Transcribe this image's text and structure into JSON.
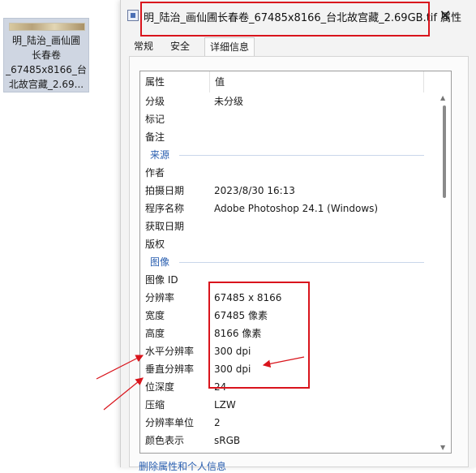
{
  "desktop": {
    "file_label": "明_陆治_画仙圃\n长春卷\n_67485x8166_台\n北故宫藏_2.69..."
  },
  "dialog": {
    "title": "明_陆治_画仙圃长春卷_67485x8166_台北故宫藏_2.69GB.tif 属性",
    "close": "✕",
    "tabs": [
      {
        "label": "常规"
      },
      {
        "label": "安全"
      },
      {
        "label": "详细信息"
      }
    ],
    "columns": {
      "property": "属性",
      "value": "值"
    },
    "rows": [
      {
        "key": "分级",
        "value": "未分级"
      },
      {
        "key": "标记",
        "value": ""
      },
      {
        "key": "备注",
        "value": ""
      },
      {
        "group": "来源"
      },
      {
        "key": "作者",
        "value": ""
      },
      {
        "key": "拍摄日期",
        "value": "2023/8/30 16:13"
      },
      {
        "key": "程序名称",
        "value": "Adobe Photoshop 24.1 (Windows)"
      },
      {
        "key": "获取日期",
        "value": ""
      },
      {
        "key": "版权",
        "value": ""
      },
      {
        "group": "图像"
      },
      {
        "key": "图像 ID",
        "value": ""
      },
      {
        "key": "分辨率",
        "value": "67485 x 8166"
      },
      {
        "key": "宽度",
        "value": "67485 像素"
      },
      {
        "key": "高度",
        "value": "8166 像素"
      },
      {
        "key": "水平分辨率",
        "value": "300 dpi"
      },
      {
        "key": "垂直分辨率",
        "value": "300 dpi"
      },
      {
        "key": "位深度",
        "value": "24"
      },
      {
        "key": "压缩",
        "value": "LZW"
      },
      {
        "key": "分辨率单位",
        "value": "2"
      },
      {
        "key": "颜色表示",
        "value": "sRGB"
      }
    ],
    "bottom_link": "删除属性和个人信息"
  },
  "annotation_color": "#d9141c"
}
